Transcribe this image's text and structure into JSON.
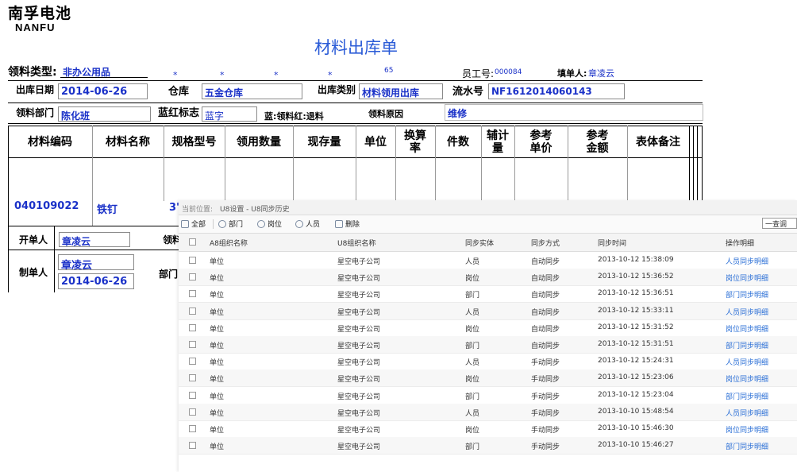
{
  "logo": {
    "cn": "南孚电池",
    "en": "NANFU"
  },
  "title": "材料出库单",
  "form": {
    "type_label": "领料类型:",
    "type_value": "非办公用品",
    "marks": [
      "*",
      "*",
      "*",
      "*"
    ],
    "num65": "65",
    "emp_label": "员工号:",
    "emp_value": "000084",
    "filler_label": "填单人:",
    "filler_value": "章凌云",
    "date_label": "出库日期",
    "date_value": "2014-06-26",
    "wh_label": "仓库",
    "wh_value": "五金仓库",
    "cat_label": "出库类别",
    "cat_value": "材料领用出库",
    "serial_label": "流水号",
    "serial_value": "NF1612014060143",
    "dept_label": "领料部门",
    "dept_value": "陈化班",
    "redblue_label": "蓝红标志",
    "redblue_value": "蓝字",
    "redblue_note": "蓝:领料红:退料",
    "reason_label": "领料原因",
    "reason_value": "维修"
  },
  "table": {
    "headers": [
      "材料编码",
      "材料名称",
      "规格型号",
      "领用数量",
      "现存量",
      "单位",
      "换算\n率",
      "件数",
      "辅计\n量",
      "参考\n单价",
      "参考\n金额",
      "表体备注"
    ],
    "row": {
      "code": "040109022",
      "name": "铁钉",
      "spec": "3'"
    }
  },
  "footer": {
    "opener_label": "开单人",
    "opener_value": "章凌云",
    "picker_label": "领料",
    "maker_label": "制单人",
    "maker_value": "章凌云",
    "maker_date": "2014-06-26",
    "dept_label": "部门"
  },
  "overlay": {
    "breadcrumb_prefix": "当前位置:",
    "breadcrumb_path": "U8设置 - U8同步历史",
    "toolbar": {
      "all": "全部",
      "dept": "部门",
      "post": "岗位",
      "person": "人员",
      "delete": "删除",
      "query": "一查调"
    },
    "columns": [
      "A8组织名称",
      "U8组织名称",
      "同步实体",
      "同步方式",
      "同步时间",
      "操作明细"
    ],
    "rows": [
      {
        "a8": "单位",
        "u8": "星空电子公司",
        "entity": "人员",
        "mode": "自动同步",
        "time": "2013-10-12 15:38:09",
        "detail": "人员同步明细"
      },
      {
        "a8": "单位",
        "u8": "星空电子公司",
        "entity": "岗位",
        "mode": "自动同步",
        "time": "2013-10-12 15:36:52",
        "detail": "岗位同步明细"
      },
      {
        "a8": "单位",
        "u8": "星空电子公司",
        "entity": "部门",
        "mode": "自动同步",
        "time": "2013-10-12 15:36:51",
        "detail": "部门同步明细"
      },
      {
        "a8": "单位",
        "u8": "星空电子公司",
        "entity": "人员",
        "mode": "自动同步",
        "time": "2013-10-12 15:33:11",
        "detail": "人员同步明细"
      },
      {
        "a8": "单位",
        "u8": "星空电子公司",
        "entity": "岗位",
        "mode": "自动同步",
        "time": "2013-10-12 15:31:52",
        "detail": "岗位同步明细"
      },
      {
        "a8": "单位",
        "u8": "星空电子公司",
        "entity": "部门",
        "mode": "自动同步",
        "time": "2013-10-12 15:31:51",
        "detail": "部门同步明细"
      },
      {
        "a8": "单位",
        "u8": "星空电子公司",
        "entity": "人员",
        "mode": "手动同步",
        "time": "2013-10-12 15:24:31",
        "detail": "人员同步明细"
      },
      {
        "a8": "单位",
        "u8": "星空电子公司",
        "entity": "岗位",
        "mode": "手动同步",
        "time": "2013-10-12 15:23:06",
        "detail": "岗位同步明细"
      },
      {
        "a8": "单位",
        "u8": "星空电子公司",
        "entity": "部门",
        "mode": "手动同步",
        "time": "2013-10-12 15:23:04",
        "detail": "部门同步明细"
      },
      {
        "a8": "单位",
        "u8": "星空电子公司",
        "entity": "人员",
        "mode": "手动同步",
        "time": "2013-10-10 15:48:54",
        "detail": "人员同步明细"
      },
      {
        "a8": "单位",
        "u8": "星空电子公司",
        "entity": "岗位",
        "mode": "手动同步",
        "time": "2013-10-10 15:46:30",
        "detail": "岗位同步明细"
      },
      {
        "a8": "单位",
        "u8": "星空电子公司",
        "entity": "部门",
        "mode": "手动同步",
        "time": "2013-10-10 15:46:27",
        "detail": "部门同步明细"
      }
    ]
  }
}
